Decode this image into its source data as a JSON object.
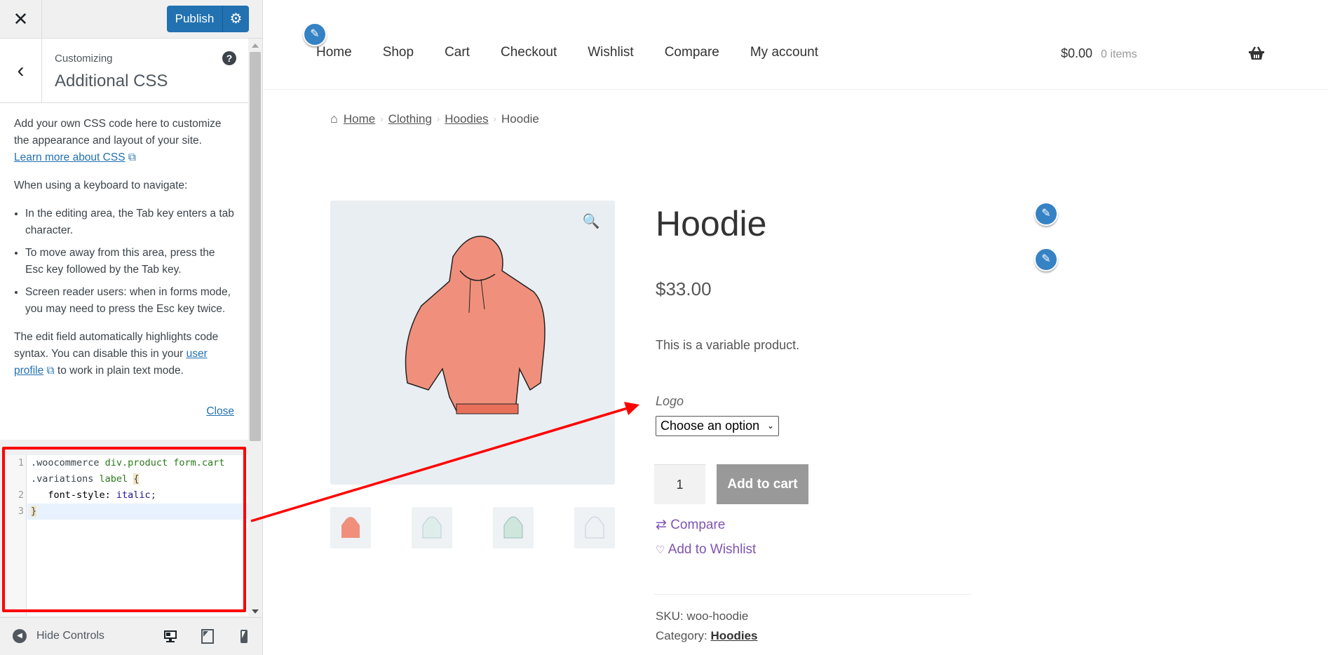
{
  "customizer": {
    "close_icon": "close-icon",
    "publish_label": "Publish",
    "section_small": "Customizing",
    "section_title": "Additional CSS",
    "help_label": "?",
    "desc": {
      "p1": "Add your own CSS code here to customize the appearance and layout of your site.",
      "learn_more": "Learn more about CSS",
      "p2": "When using a keyboard to navigate:",
      "bullets": [
        "In the editing area, the Tab key enters a tab character.",
        "To move away from this area, press the Esc key followed by the Tab key.",
        "Screen reader users: when in forms mode, you may need to press the Esc key twice."
      ],
      "p3_a": "The edit field automatically highlights code syntax. You can disable this in your ",
      "p3_link": "user profile",
      "p3_b": " to work in plain text mode.",
      "close": "Close"
    },
    "code": {
      "line_numbers": [
        "1",
        "2",
        "3"
      ],
      "l1_a": ".woocommerce ",
      "l1_b": "div.product form.cart",
      "l1c_a": ".variations ",
      "l1c_b": "label",
      "l1c_c": "{",
      "l2_a": "   font-style: ",
      "l2_b": "italic",
      "l2_c": ";",
      "l3": "}"
    },
    "footer": {
      "hide_controls": "Hide Controls"
    }
  },
  "site": {
    "nav": [
      "Home",
      "Shop",
      "Cart",
      "Checkout",
      "Wishlist",
      "Compare",
      "My account"
    ],
    "cart_total": "$0.00",
    "cart_items": "0 items",
    "breadcrumb": [
      "Home",
      "Clothing",
      "Hoodies",
      "Hoodie"
    ],
    "product": {
      "title": "Hoodie",
      "price": "$33.00",
      "description": "This is a variable product.",
      "attribute_label": "Logo",
      "select_value": "Choose an option",
      "quantity": "1",
      "add_to_cart": "Add to cart",
      "compare": "Compare",
      "wishlist": "Add to Wishlist",
      "sku_label": "SKU:",
      "sku": "woo-hoodie",
      "category_label": "Category:",
      "category": "Hoodies"
    }
  },
  "colors": {
    "accent": "#2271b1",
    "highlight": "#ff0000",
    "link_purple": "#7f54b3",
    "hoodie": "#f0907c"
  }
}
